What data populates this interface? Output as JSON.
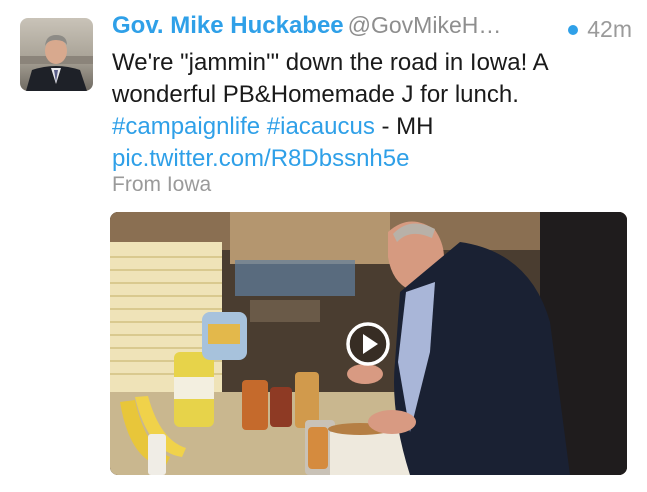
{
  "tweet": {
    "author_name": "Gov. Mike Huckabee",
    "handle": "@GovMikeH…",
    "time": "42m",
    "text": "We're \"jammin'\" down the road in Iowa! A wonderful PB&Homemade J for lunch.",
    "hashtag1": "#campaignlife",
    "hashtag2": "#iacaucus",
    "signature": " - MH",
    "media_link": "pic.twitter.com/R8Dbssnh5e",
    "location": "From Iowa"
  },
  "colors": {
    "accent": "#2fa0e8",
    "secondary_text": "#9a9a9a",
    "body_text": "#1a1a1a"
  },
  "icons": {
    "play": "play-icon",
    "unread": "unread-dot"
  }
}
